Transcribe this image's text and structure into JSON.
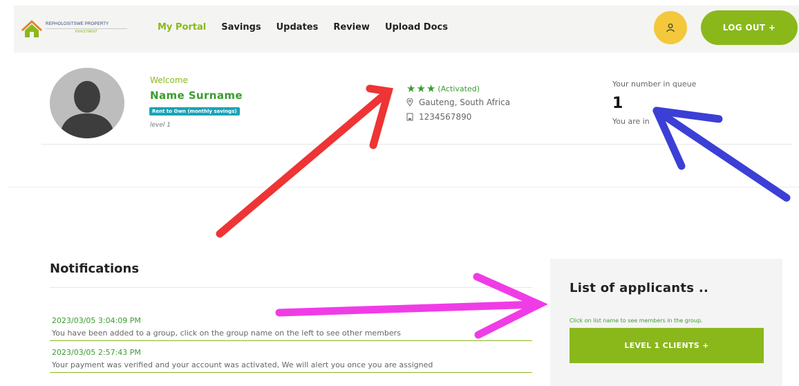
{
  "header": {
    "logo": {
      "line1": "REPHOLOSITSWE PROPERTY",
      "line2": "INVESTMENT"
    },
    "nav": [
      {
        "label": "My Portal",
        "active": true
      },
      {
        "label": "Savings",
        "active": false
      },
      {
        "label": "Updates",
        "active": false
      },
      {
        "label": "Review",
        "active": false
      },
      {
        "label": "Upload Docs",
        "active": false
      }
    ],
    "user_icon": "user-icon",
    "logout_label": "LOG OUT +"
  },
  "profile": {
    "welcome": "Welcome",
    "name": "Name  Surname",
    "plan_badge": "Rent to Own (monthly savings)",
    "level": "level 1",
    "stars": "★★★",
    "status": "(Activated)",
    "location": "Gauteng, South Africa",
    "phone": "1234567890"
  },
  "queue": {
    "label": "Your number in queue",
    "number": "1",
    "subtext": "You are in"
  },
  "notifications": {
    "title": "Notifications",
    "items": [
      {
        "time": "2023/03/05 3:04:09 PM",
        "message": "You have been added to a group, click on the group name on the left to see other members"
      },
      {
        "time": "2023/03/05 2:57:43 PM",
        "message": "Your payment was verified and your account was activated, We will alert you once you are assigned"
      }
    ]
  },
  "applicants": {
    "title": "List of applicants ..",
    "hint": "Click on list name to see members in the group.",
    "button_label": "LEVEL 1 CLIENTS  +"
  },
  "colors": {
    "brand_green": "#8ab81b",
    "text_green": "#3a9d2f",
    "badge_teal": "#1aa3b8",
    "user_yellow": "#f3c83a",
    "arrow_red": "#ee3434",
    "arrow_blue": "#3b3fd6",
    "arrow_magenta": "#f03ce6"
  }
}
